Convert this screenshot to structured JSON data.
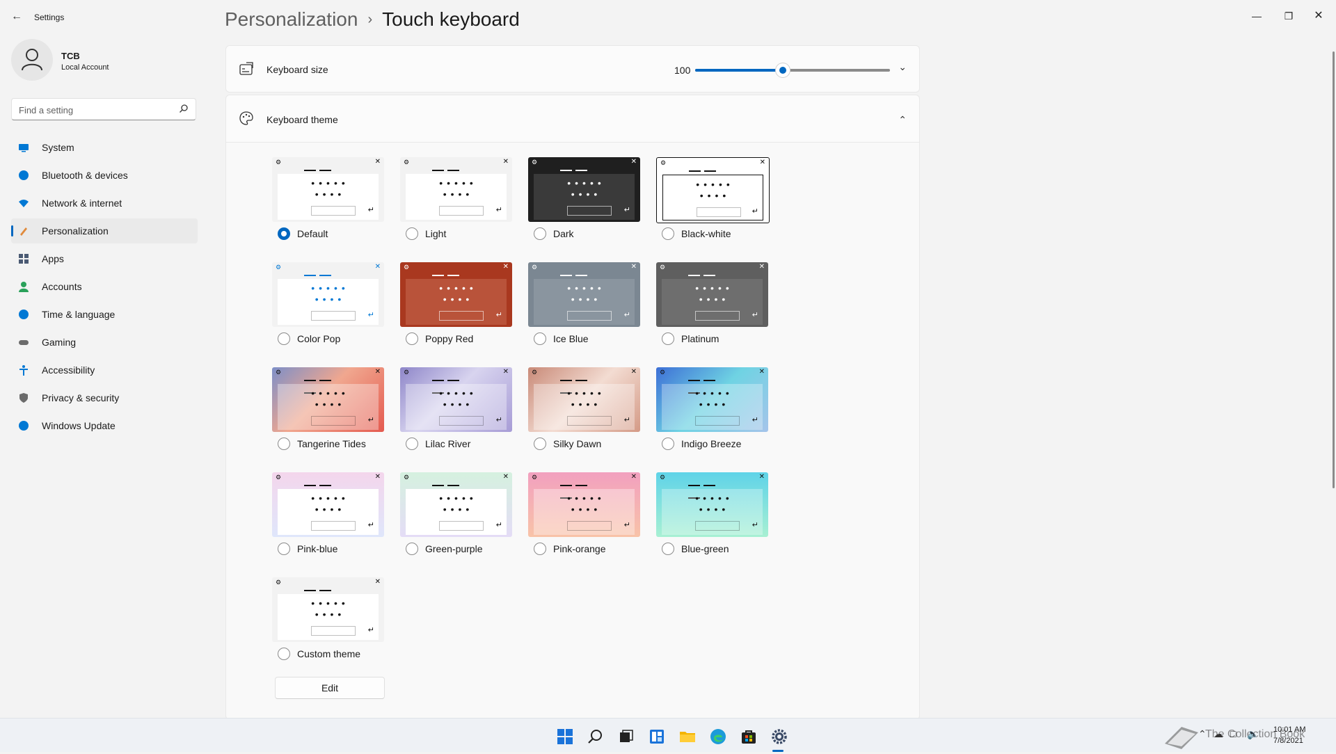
{
  "window": {
    "title": "Settings",
    "back_icon": "back-arrow-icon",
    "controls": [
      "minimize",
      "maximize",
      "close"
    ]
  },
  "profile": {
    "name": "TCB",
    "account_type": "Local Account"
  },
  "search": {
    "placeholder": "Find a setting"
  },
  "sidebar": {
    "items": [
      {
        "label": "System",
        "icon": "system-icon",
        "color": "#0078d4",
        "selected": false
      },
      {
        "label": "Bluetooth & devices",
        "icon": "bluetooth-icon",
        "color": "#0078d4",
        "selected": false
      },
      {
        "label": "Network & internet",
        "icon": "network-icon",
        "color": "#0078d4",
        "selected": false
      },
      {
        "label": "Personalization",
        "icon": "brush-icon",
        "color": "#e08a3c",
        "selected": true
      },
      {
        "label": "Apps",
        "icon": "apps-icon",
        "color": "#4a5a73",
        "selected": false
      },
      {
        "label": "Accounts",
        "icon": "accounts-icon",
        "color": "#2aa15a",
        "selected": false
      },
      {
        "label": "Time & language",
        "icon": "time-language-icon",
        "color": "#0078d4",
        "selected": false
      },
      {
        "label": "Gaming",
        "icon": "gaming-icon",
        "color": "#6b6b6b",
        "selected": false
      },
      {
        "label": "Accessibility",
        "icon": "accessibility-icon",
        "color": "#0078d4",
        "selected": false
      },
      {
        "label": "Privacy & security",
        "icon": "shield-icon",
        "color": "#6b6b6b",
        "selected": false
      },
      {
        "label": "Windows Update",
        "icon": "windows-update-icon",
        "color": "#0078d4",
        "selected": false
      }
    ]
  },
  "header": {
    "parent": "Personalization",
    "separator": "›",
    "current": "Touch keyboard"
  },
  "keyboard_size": {
    "label": "Keyboard size",
    "value": "100",
    "slider_fraction": 0.45,
    "accent": "#0067c0"
  },
  "keyboard_theme": {
    "label": "Keyboard theme",
    "themes": [
      {
        "name": "Default",
        "selected": true,
        "bg": "#f2f2f2",
        "panel": "#ffffff",
        "fg": "#111111",
        "border": "none"
      },
      {
        "name": "Light",
        "selected": false,
        "bg": "#f2f2f2",
        "panel": "#ffffff",
        "fg": "#111111",
        "border": "none"
      },
      {
        "name": "Dark",
        "selected": false,
        "bg": "#1f1f1f",
        "panel": "#3a3a3a",
        "fg": "#ffffff",
        "border": "none"
      },
      {
        "name": "Black-white",
        "selected": false,
        "bg": "#ffffff",
        "panel": "#ffffff",
        "fg": "#111111",
        "border": "#111111"
      },
      {
        "name": "Color Pop",
        "selected": false,
        "bg": "#f2f2f2",
        "panel": "#ffffff",
        "fg": "#0078d4",
        "border": "none"
      },
      {
        "name": "Poppy Red",
        "selected": false,
        "bg": "#a9381f",
        "panel": "#b9533a",
        "fg": "#ffffff",
        "border": "none"
      },
      {
        "name": "Ice Blue",
        "selected": false,
        "bg": "#7b8792",
        "panel": "#8a959f",
        "fg": "#ffffff",
        "border": "none"
      },
      {
        "name": "Platinum",
        "selected": false,
        "bg": "#5f5f5f",
        "panel": "#6e6e6e",
        "fg": "#ffffff",
        "border": "none"
      },
      {
        "name": "Tangerine Tides",
        "selected": false,
        "bg": "linear-gradient(135deg,#7d8fc8 0%,#f0a78f 45%,#e45a4f 100%)",
        "panel": "rgba(255,255,255,0.35)",
        "fg": "#111111",
        "border": "none"
      },
      {
        "name": "Lilac River",
        "selected": false,
        "bg": "linear-gradient(135deg,#8e86c9 0%,#d8d4ef 45%,#a79cd6 100%)",
        "panel": "rgba(255,255,255,0.35)",
        "fg": "#111111",
        "border": "none"
      },
      {
        "name": "Silky Dawn",
        "selected": false,
        "bg": "linear-gradient(135deg,#c98a78 0%,#f3dcd2 50%,#d49a86 100%)",
        "panel": "rgba(255,255,255,0.35)",
        "fg": "#111111",
        "border": "none"
      },
      {
        "name": "Indigo Breeze",
        "selected": false,
        "bg": "linear-gradient(135deg,#3d6fd6 0%,#6fd3e3 50%,#a5c4ea 100%)",
        "panel": "rgba(255,255,255,0.3)",
        "fg": "#111111",
        "border": "none"
      },
      {
        "name": "Pink-blue",
        "selected": false,
        "bg": "linear-gradient(180deg,#f4d6ec 0%,#dfe6fb 100%)",
        "panel": "#ffffff",
        "fg": "#111111",
        "border": "none"
      },
      {
        "name": "Green-purple",
        "selected": false,
        "bg": "linear-gradient(180deg,#d5f1df 0%,#e4dcf6 100%)",
        "panel": "#ffffff",
        "fg": "#111111",
        "border": "none"
      },
      {
        "name": "Pink-orange",
        "selected": false,
        "bg": "linear-gradient(180deg,#f2a0bf 0%,#f8c3a8 100%)",
        "panel": "rgba(255,255,255,0.35)",
        "fg": "#111111",
        "border": "none"
      },
      {
        "name": "Blue-green",
        "selected": false,
        "bg": "linear-gradient(180deg,#5fd3e8 0%,#a8f0d3 100%)",
        "panel": "rgba(255,255,255,0.3)",
        "fg": "#111111",
        "border": "none"
      },
      {
        "name": "Custom theme",
        "selected": false,
        "bg": "#f2f2f2",
        "panel": "#ffffff",
        "fg": "#111111",
        "border": "none"
      }
    ],
    "edit_label": "Edit"
  },
  "taskbar": {
    "icons": [
      "windows-start-icon",
      "search-icon",
      "task-view-icon",
      "widgets-icon",
      "file-explorer-icon",
      "edge-icon",
      "store-icon",
      "settings-icon"
    ],
    "active": "settings-icon",
    "watermark": "The Collection Book",
    "tray_icons": [
      "chevron-up-icon",
      "cloud-icon",
      "display-icon",
      "volume-icon"
    ],
    "time": "10:01 AM",
    "date": "7/8/2021"
  }
}
